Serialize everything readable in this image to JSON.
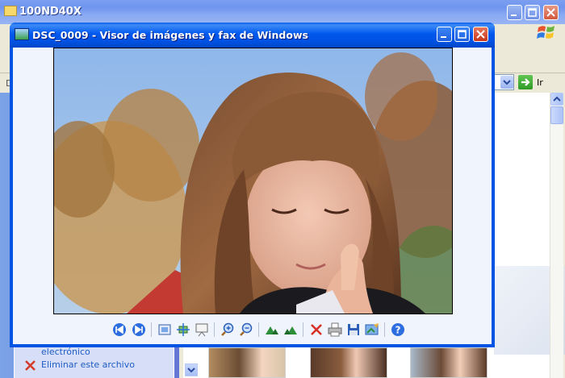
{
  "explorer": {
    "title": "100ND40X",
    "address_prefix": "D",
    "go_label": "Ir",
    "tasks": {
      "email_label": "electrónico",
      "delete_label": "Eliminar este archivo"
    }
  },
  "viewer": {
    "title": "DSC_0009 - Visor de imágenes y fax de Windows",
    "toolbar": {
      "buttons": [
        "previous-image-icon",
        "next-image-icon",
        "best-fit-icon",
        "actual-size-icon",
        "slideshow-icon",
        "zoom-in-icon",
        "zoom-out-icon",
        "rotate-clockwise-icon",
        "rotate-counterclockwise-icon",
        "delete-icon",
        "print-icon",
        "save-copy-icon",
        "edit-icon",
        "help-icon"
      ]
    }
  },
  "colors": {
    "xp_blue": "#0054e3",
    "title_text": "#ffffff",
    "link_blue": "#215dc6",
    "close_red": "#d2583c"
  }
}
